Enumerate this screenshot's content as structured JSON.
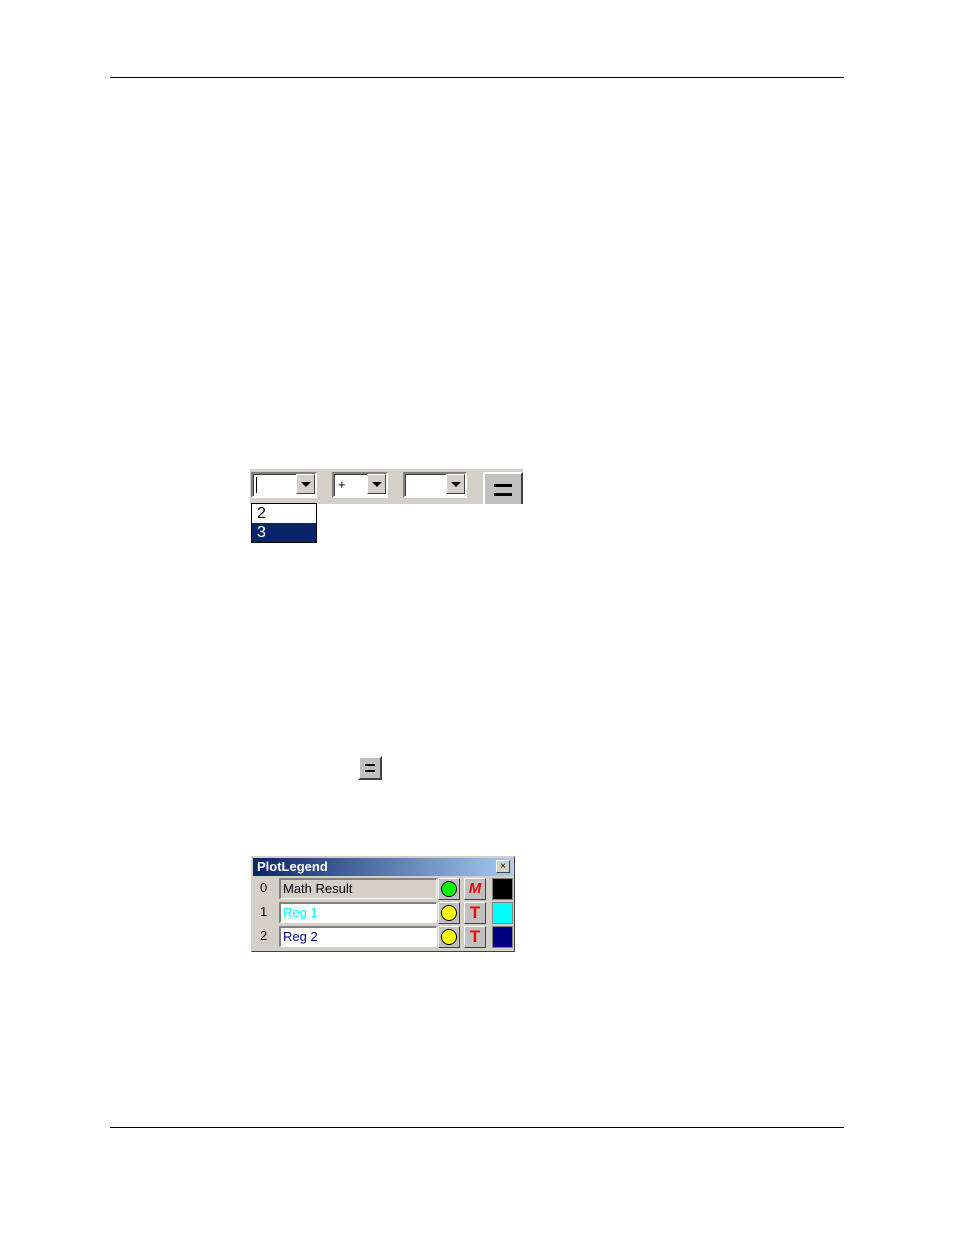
{
  "document": {
    "header_rule": true,
    "footer_rule": true
  },
  "toolbar": {
    "operand1": {
      "value": "",
      "options_visible": [
        "2",
        "3"
      ],
      "selected": "3"
    },
    "operator": {
      "value": "+"
    },
    "operand2": {
      "value": ""
    },
    "equals_label": "="
  },
  "inline_button": {
    "label": "="
  },
  "plot_legend": {
    "title": "PlotLegend",
    "close_label": "×",
    "rows": [
      {
        "index": "0",
        "name": "Math Result",
        "name_color": "#000000",
        "symbol_color": "#00ff00",
        "style_glyph": "M",
        "color": "#000000",
        "editable": false
      },
      {
        "index": "1",
        "name": "Reg 1",
        "name_color": "#00ffff",
        "symbol_color": "#ffff00",
        "style_glyph": "T",
        "color": "#00ffff",
        "editable": true
      },
      {
        "index": "2",
        "name": "Reg 2",
        "name_color": "#000080",
        "symbol_color": "#ffff00",
        "style_glyph": "T",
        "color": "#000080",
        "editable": true
      }
    ]
  },
  "colors": {
    "selection": "#0a246a",
    "window_face": "#d4d0c8",
    "style_glyph": "#ff0000"
  }
}
